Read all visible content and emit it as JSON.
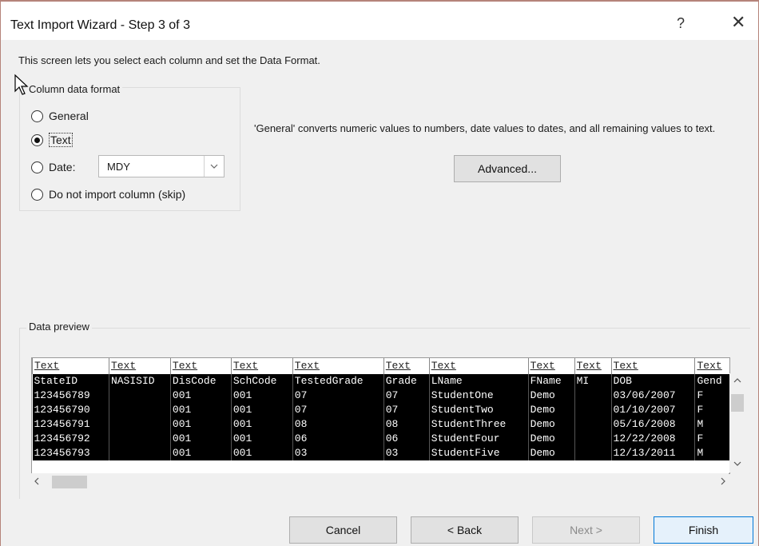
{
  "window": {
    "title": "Text Import Wizard - Step 3 of 3",
    "help_glyph": "?",
    "close_glyph": "✕"
  },
  "intro": "This screen lets you select each column and set the Data Format.",
  "format": {
    "legend": "Column data format",
    "options": [
      {
        "label": "General",
        "checked": false
      },
      {
        "label": "Text",
        "checked": true
      },
      {
        "label": "Date:",
        "checked": false
      },
      {
        "label": "Do not import column (skip)",
        "checked": false
      }
    ],
    "date_value": "MDY",
    "description": "'General' converts numeric values to numbers, date values to dates, and all remaining values to text.",
    "advanced_label": "Advanced..."
  },
  "preview": {
    "legend": "Data preview",
    "column_types": [
      "Text",
      "Text",
      "Text",
      "Text",
      "Text",
      "Text",
      "Text",
      "Text",
      "Text",
      "Text",
      "Text"
    ],
    "rows": [
      [
        "StateID",
        "NASISID",
        "DisCode",
        "SchCode",
        "TestedGrade",
        "Grade",
        "LName",
        "FName",
        "MI",
        "DOB",
        "Gend"
      ],
      [
        "123456789",
        "",
        "001",
        "001",
        "07",
        "07",
        "StudentOne",
        "Demo",
        "",
        "03/06/2007",
        "F"
      ],
      [
        "123456790",
        "",
        "001",
        "001",
        "07",
        "07",
        "StudentTwo",
        "Demo",
        "",
        "01/10/2007",
        "F"
      ],
      [
        "123456791",
        "",
        "001",
        "001",
        "08",
        "08",
        "StudentThree",
        "Demo",
        "",
        "05/16/2008",
        "M"
      ],
      [
        "123456792",
        "",
        "001",
        "001",
        "06",
        "06",
        "StudentFour",
        "Demo",
        "",
        "12/22/2008",
        "F"
      ],
      [
        "123456793",
        "",
        "001",
        "001",
        "03",
        "03",
        "StudentFive",
        "Demo",
        "",
        "12/13/2011",
        "M"
      ]
    ]
  },
  "buttons": {
    "cancel": "Cancel",
    "back": "< Back",
    "next": "Next >",
    "finish": "Finish"
  }
}
